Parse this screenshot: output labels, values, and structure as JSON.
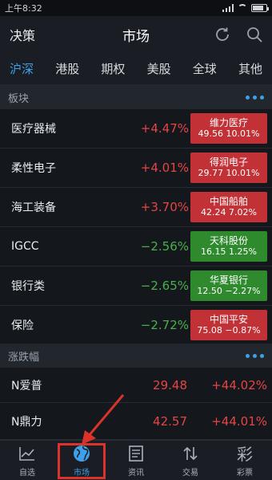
{
  "status": {
    "time": "上午8:32"
  },
  "header": {
    "left_label": "决策",
    "title": "市场",
    "refresh_icon": "refresh-icon",
    "search_icon": "search-icon"
  },
  "tabs": [
    {
      "label": "沪深",
      "active": true
    },
    {
      "label": "港股",
      "active": false
    },
    {
      "label": "期权",
      "active": false
    },
    {
      "label": "美股",
      "active": false
    },
    {
      "label": "全球",
      "active": false
    },
    {
      "label": "其他",
      "active": false
    }
  ],
  "sectors": {
    "title": "板块",
    "rows": [
      {
        "name": "医疗器械",
        "change": "+4.47%",
        "stock_name": "维力医疗",
        "stock_quote": "49.56 10.01%",
        "trend": "up"
      },
      {
        "name": "柔性电子",
        "change": "+4.01%",
        "stock_name": "得润电子",
        "stock_quote": "29.77 10.01%",
        "trend": "up"
      },
      {
        "name": "海工装备",
        "change": "+3.70%",
        "stock_name": "中国船舶",
        "stock_quote": "42.24 7.02%",
        "trend": "up"
      },
      {
        "name": "IGCC",
        "change": "−2.56%",
        "stock_name": "天科股份",
        "stock_quote": "16.15 1.25%",
        "trend": "down",
        "box": "green"
      },
      {
        "name": "银行类",
        "change": "−2.65%",
        "stock_name": "华夏银行",
        "stock_quote": "12.50 −2.27%",
        "trend": "down",
        "box": "green"
      },
      {
        "name": "保险",
        "change": "−2.72%",
        "stock_name": "中国平安",
        "stock_quote": "75.08 −0.87%",
        "trend": "down",
        "box": "red"
      }
    ]
  },
  "gainers": {
    "title": "涨跌幅",
    "rows": [
      {
        "name": "N爱普",
        "price": "29.48",
        "pct": "+44.02%"
      },
      {
        "name": "N鼎力",
        "price": "42.57",
        "pct": "+44.01%"
      }
    ]
  },
  "bottom_nav": [
    {
      "label": "自选",
      "icon": "line-chart-icon"
    },
    {
      "label": "市场",
      "icon": "globe-icon",
      "active": true
    },
    {
      "label": "资讯",
      "icon": "newspaper-icon"
    },
    {
      "label": "交易",
      "icon": "transfer-icon"
    },
    {
      "label": "彩票",
      "icon": "lottery-icon"
    }
  ],
  "colors": {
    "accent": "#3ea0e8",
    "up": "#e64545",
    "down": "#4ab04a",
    "highlight": "#d9332c"
  }
}
